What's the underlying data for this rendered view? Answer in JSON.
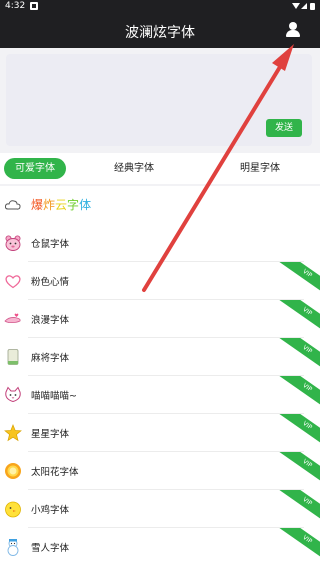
{
  "status_bar": {
    "time": "4:32"
  },
  "app_bar": {
    "title": "波澜炫字体"
  },
  "compose": {
    "send_label": "发送"
  },
  "tabs": [
    {
      "label": "可爱字体",
      "active": true
    },
    {
      "label": "经典字体",
      "active": false
    },
    {
      "label": "明星字体",
      "active": false
    }
  ],
  "font_list": [
    {
      "label": "爆炸云字体",
      "icon": "cloud-icon",
      "vip": false,
      "rainbow": true
    },
    {
      "label": "仓鼠字体",
      "icon": "hamster-icon",
      "vip": false
    },
    {
      "label": "粉色心情",
      "icon": "heart-icon",
      "vip": true
    },
    {
      "label": "浪漫字体",
      "icon": "romantic-icon",
      "vip": true
    },
    {
      "label": "麻将字体",
      "icon": "mahjong-icon",
      "vip": true
    },
    {
      "label": "喵喵喵喵~",
      "icon": "cat-icon",
      "vip": true
    },
    {
      "label": "星星字体",
      "icon": "star-icon",
      "vip": true
    },
    {
      "label": "太阳花字体",
      "icon": "sunflower-icon",
      "vip": true
    },
    {
      "label": "小鸡字体",
      "icon": "chick-icon",
      "vip": true
    },
    {
      "label": "雪人字体",
      "icon": "snowman-icon",
      "vip": true
    }
  ],
  "vip_badge_label": "VIP",
  "colors": {
    "accent": "#31b44a",
    "bar": "#1f1f22",
    "annotation_arrow": "#e0413e"
  }
}
